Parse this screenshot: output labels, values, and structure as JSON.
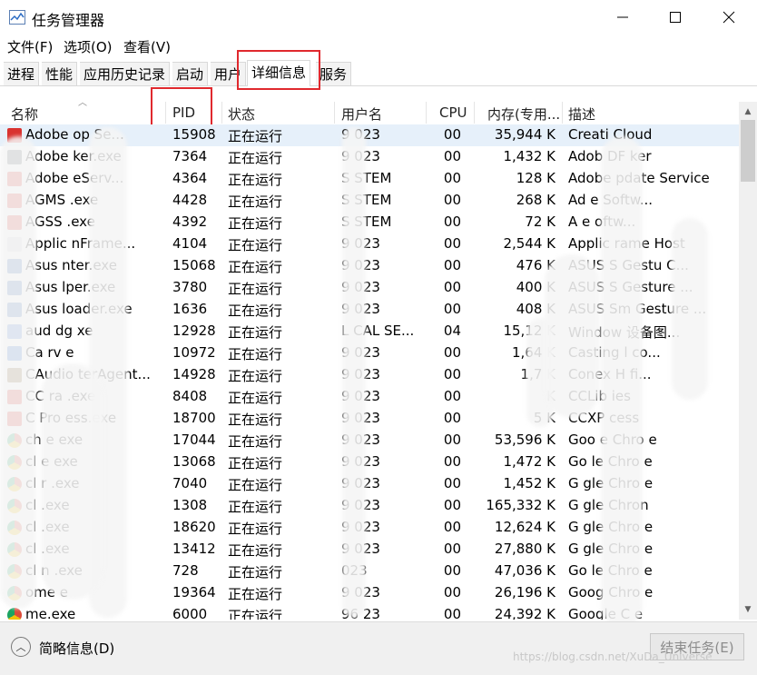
{
  "window": {
    "title": "任务管理器",
    "minimize_glyph": "—",
    "maximize_glyph": "☐",
    "close_glyph": "✕"
  },
  "menu": [
    "文件(F)",
    "选项(O)",
    "查看(V)"
  ],
  "tabs": [
    "进程",
    "性能",
    "应用历史记录",
    "启动",
    "用户",
    "详细信息",
    "服务"
  ],
  "active_tab": "详细信息",
  "columns": {
    "name": "名称",
    "pid": "PID",
    "status": "状态",
    "user": "用户名",
    "cpu": "CPU",
    "mem": "内存(专用...",
    "desc": "描述"
  },
  "rows": [
    {
      "icon": "adobe-icon",
      "color": "#d9322f",
      "name": "Adobe    op Se...",
      "pid": "15908",
      "status": "正在运行",
      "user": "9  023",
      "cpu": "00",
      "mem": "35,944 K",
      "desc": "Creati   Cloud"
    },
    {
      "icon": "app-icon",
      "color": "#555b66",
      "name": "Adobe     ker.exe",
      "pid": "7364",
      "status": "正在运行",
      "user": "9  023",
      "cpu": "00",
      "mem": "1,432 K",
      "desc": "Adob   DF   ker"
    },
    {
      "icon": "app-icon",
      "color": "#d9322f",
      "name": "Adobe     eServ...",
      "pid": "4364",
      "status": "正在运行",
      "user": "S  STEM",
      "cpu": "00",
      "mem": "128 K",
      "desc": "Adobe    pdate Service"
    },
    {
      "icon": "app-icon",
      "color": "#d9322f",
      "name": "AGMS     .exe",
      "pid": "4428",
      "status": "正在运行",
      "user": "S  STEM",
      "cpu": "00",
      "mem": "268 K",
      "desc": "Ad       e  Softw..."
    },
    {
      "icon": "app-icon",
      "color": "#d9322f",
      "name": "AGSS     .exe",
      "pid": "4392",
      "status": "正在运行",
      "user": "S  STEM",
      "cpu": "00",
      "mem": "72 K",
      "desc": "A        e  oftw..."
    },
    {
      "icon": "frame-icon",
      "color": "#d0d4da",
      "name": "Applic     nFrame...",
      "pid": "4104",
      "status": "正在运行",
      "user": "9  023",
      "cpu": "00",
      "mem": "2,544 K",
      "desc": "Applic   rame Host"
    },
    {
      "icon": "asus-icon",
      "color": "#3f6fb5",
      "name": "Asus      nter.exe",
      "pid": "15068",
      "status": "正在运行",
      "user": "9  023",
      "cpu": "00",
      "mem": "476 K",
      "desc": "ASUS S   Gestu  C..."
    },
    {
      "icon": "asus-icon",
      "color": "#3f6fb5",
      "name": "Asus     lper.exe",
      "pid": "3780",
      "status": "正在运行",
      "user": "9  023",
      "cpu": "00",
      "mem": "400 K",
      "desc": "ASUS S   Gesture ..."
    },
    {
      "icon": "asus-icon",
      "color": "#3f6fb5",
      "name": "Asus    loader.exe",
      "pid": "1636",
      "status": "正在运行",
      "user": "9  023",
      "cpu": "00",
      "mem": "408 K",
      "desc": "ASUS Sm  Gesture ..."
    },
    {
      "icon": "audio-icon",
      "color": "#4a7fd0",
      "name": "aud    dg   xe",
      "pid": "12928",
      "status": "正在运行",
      "user": "L  CAL SE...",
      "cpu": "04",
      "mem": "15,12  K",
      "desc": "Window    设备图..."
    },
    {
      "icon": "cast-icon",
      "color": "#2c6cc8",
      "name": "Ca   rv    e",
      "pid": "10972",
      "status": "正在运行",
      "user": "9  023",
      "cpu": "00",
      "mem": "1,64  K",
      "desc": "Casting    l co..."
    },
    {
      "icon": "tool-icon",
      "color": "#7a5d2e",
      "name": "CAudio   terAgent...",
      "pid": "14928",
      "status": "正在运行",
      "user": "9  023",
      "cpu": "00",
      "mem": "1,7   K",
      "desc": "Conex   H   fi..."
    },
    {
      "icon": "adobe-icon",
      "color": "#d9322f",
      "name": "CC     ra   .exe",
      "pid": "8408",
      "status": "正在运行",
      "user": "9  023",
      "cpu": "00",
      "mem": "  K",
      "desc": "CCLib   ies"
    },
    {
      "icon": "adobe-icon",
      "color": "#d9322f",
      "name": "C   Pro  ess.exe",
      "pid": "18700",
      "status": "正在运行",
      "user": "9  023",
      "cpu": "00",
      "mem": "  5 K",
      "desc": "CCXP   cess"
    },
    {
      "icon": "chrome-icon",
      "color": "#dd4b39",
      "name": "ch    e   exe",
      "pid": "17044",
      "status": "正在运行",
      "user": "9  023",
      "cpu": "00",
      "mem": "53,596 K",
      "desc": "Goo   e Chro  e"
    },
    {
      "icon": "chrome-icon",
      "color": "#dd4b39",
      "name": "cl     e   exe",
      "pid": "13068",
      "status": "正在运行",
      "user": "9  023",
      "cpu": "00",
      "mem": "1,472 K",
      "desc": "Go   le Chro  e"
    },
    {
      "icon": "chrome-icon",
      "color": "#dd4b39",
      "name": "cl     r   .exe",
      "pid": "7040",
      "status": "正在运行",
      "user": "9  023",
      "cpu": "00",
      "mem": "1,452 K",
      "desc": "G   gle Chro  e"
    },
    {
      "icon": "chrome-icon",
      "color": "#dd4b39",
      "name": "cl      .exe",
      "pid": "1308",
      "status": "正在运行",
      "user": "9  023",
      "cpu": "00",
      "mem": "165,332 K",
      "desc": "G   gle Chron"
    },
    {
      "icon": "chrome-icon",
      "color": "#dd4b39",
      "name": "cl      .exe",
      "pid": "18620",
      "status": "正在运行",
      "user": "9  023",
      "cpu": "00",
      "mem": "12,624 K",
      "desc": "G   gle Chro  e"
    },
    {
      "icon": "chrome-icon",
      "color": "#dd4b39",
      "name": "cl      .exe",
      "pid": "13412",
      "status": "正在运行",
      "user": "9  023",
      "cpu": "00",
      "mem": "27,880 K",
      "desc": "G   gle Chro  e"
    },
    {
      "icon": "chrome-icon",
      "color": "#dd4b39",
      "name": "cl   n   .exe",
      "pid": "728",
      "status": "正在运行",
      "user": "  023",
      "cpu": "00",
      "mem": "47,036 K",
      "desc": "Go   le Chro  e"
    },
    {
      "icon": "chrome-icon",
      "color": "#dd4b39",
      "name": "  ome   e",
      "pid": "19364",
      "status": "正在运行",
      "user": "9  023",
      "cpu": "00",
      "mem": "26,196 K",
      "desc": "Goog   Chro  e"
    },
    {
      "icon": "chrome-icon",
      "color": "#dd4b39",
      "name": "   me.exe",
      "pid": "6000",
      "status": "正在运行",
      "user": "96  23",
      "cpu": "00",
      "mem": "24,392 K",
      "desc": "Google C    e"
    }
  ],
  "footer": {
    "less_info_label": "简略信息(D)",
    "end_task_label": "结束任务(E)"
  },
  "watermark": "https://blog.csdn.net/XuDa_Universe"
}
